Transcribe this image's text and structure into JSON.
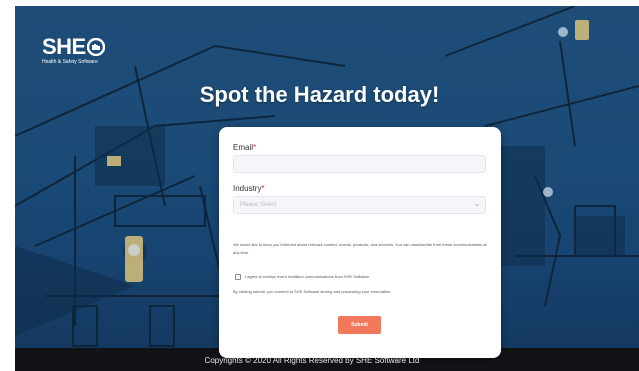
{
  "logo": {
    "brand": "SHE",
    "tagline": "Health & Safety Software"
  },
  "headline": "Spot the Hazard today!",
  "form": {
    "email_label": "Email",
    "email_value": "",
    "industry_label": "Industry",
    "required_marker": "*",
    "industry_selected": "Please Select",
    "consent_text": "We would like to keep you informed about relevant content, events, products, and services. You can unsubscribe from these communications at any time.",
    "checkbox_label": "I agree to receive event invitation communications from SHE Software.",
    "submit_notice": "By clicking submit, you consent to SHE Software storing and processing your information.",
    "submit_label": "Submit"
  },
  "footer": {
    "copyright": "Copyrights © 2020 All Rights Reserved by SHE Software Ltd"
  },
  "colors": {
    "background": "#1f4d78",
    "accent": "#f2785c",
    "required": "#d63333",
    "footer": "#111317"
  }
}
